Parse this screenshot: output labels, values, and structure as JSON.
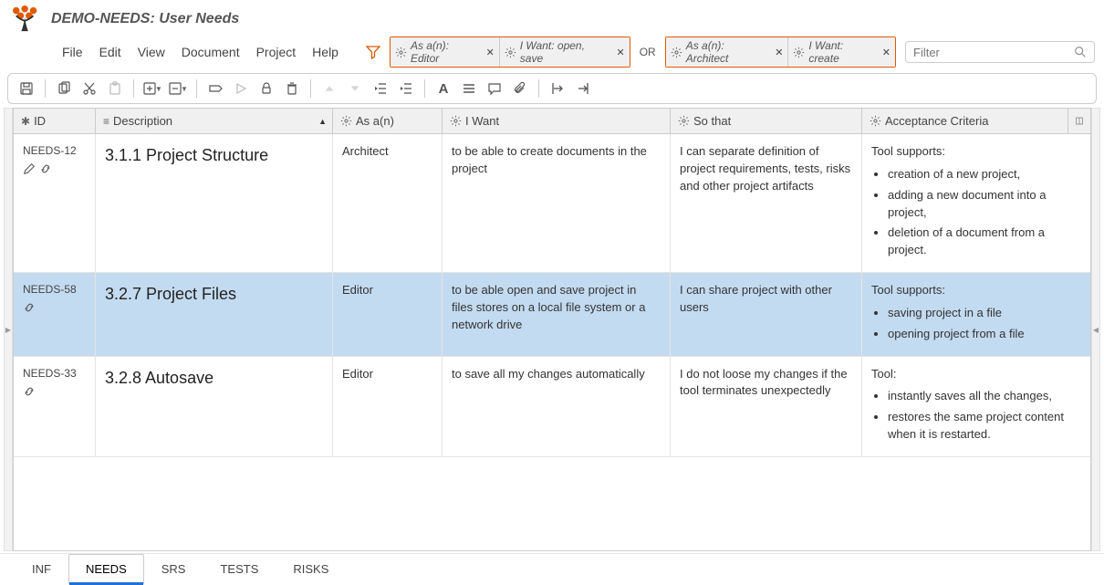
{
  "app_title": "DEMO-NEEDS: User Needs",
  "menu": [
    "File",
    "Edit",
    "View",
    "Document",
    "Project",
    "Help"
  ],
  "filter": {
    "group1": [
      {
        "label": "As a(n): Editor"
      },
      {
        "label": "I Want: open, save"
      }
    ],
    "or": "OR",
    "group2": [
      {
        "label": "As a(n): Architect"
      },
      {
        "label": "I Want: create"
      }
    ],
    "placeholder": "Filter"
  },
  "columns": {
    "id": "ID",
    "description": "Description",
    "as_an": "As a(n)",
    "i_want": "I Want",
    "so_that": "So that",
    "acceptance": "Acceptance Criteria"
  },
  "rows": [
    {
      "id": "NEEDS-12",
      "desc": "3.1.1 Project Structure",
      "as_an": "Architect",
      "i_want": "to be able to create documents in the project",
      "so_that": "I can separate definition of project requirements, tests, risks and other project artifacts",
      "acc_intro": "Tool supports:",
      "acc_items": [
        "creation of a new project,",
        "adding a new document into a project,",
        "deletion of a document from a project."
      ],
      "selected": false,
      "show_edit_icon": true
    },
    {
      "id": "NEEDS-58",
      "desc": "3.2.7 Project Files",
      "as_an": "Editor",
      "i_want": "to be able open and save project in files stores on a local file system or a network drive",
      "so_that": "I can share project with other users",
      "acc_intro": "Tool supports:",
      "acc_items": [
        "saving project in a file",
        "opening project from a file"
      ],
      "selected": true,
      "show_edit_icon": false
    },
    {
      "id": "NEEDS-33",
      "desc": "3.2.8 Autosave",
      "as_an": "Editor",
      "i_want": "to save all my changes automatically",
      "so_that": "I do not loose my changes if the tool terminates unexpectedly",
      "acc_intro": "Tool:",
      "acc_items": [
        "instantly saves all the changes,",
        "restores the same project content when it is restarted."
      ],
      "selected": false,
      "show_edit_icon": false
    }
  ],
  "tabs": [
    {
      "label": "INF",
      "active": false
    },
    {
      "label": "NEEDS",
      "active": true
    },
    {
      "label": "SRS",
      "active": false
    },
    {
      "label": "TESTS",
      "active": false
    },
    {
      "label": "RISKS",
      "active": false
    }
  ]
}
